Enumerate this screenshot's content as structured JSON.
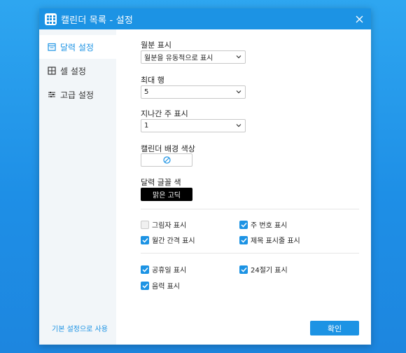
{
  "window": {
    "title": "캘린더 목록 - 설정"
  },
  "sidebar": {
    "items": [
      {
        "label": "달력 설정"
      },
      {
        "label": "셀 설정"
      },
      {
        "label": "고급 설정"
      }
    ]
  },
  "settings": {
    "month_display": {
      "label": "월분 표시",
      "value": "월분을 유동적으로 표시"
    },
    "max_rows": {
      "label": "최대 행",
      "value": "5"
    },
    "past_weeks": {
      "label": "지나간 주 표시",
      "value": "1"
    },
    "bg_color": {
      "label": "캘린더 배경 색상"
    },
    "font_color": {
      "label": "달력 글꼴 색",
      "value": "맑은 고딕"
    }
  },
  "checkboxes": {
    "shadow": {
      "label": "그림자 표시",
      "checked": false
    },
    "week_number": {
      "label": "주 번호 표시",
      "checked": true
    },
    "month_gap": {
      "label": "월간 간격 표시",
      "checked": true
    },
    "title_bar": {
      "label": "제목 표시줄 표시",
      "checked": true
    },
    "holidays": {
      "label": "공휴일 표시",
      "checked": true
    },
    "solar_terms": {
      "label": "24절기 표시",
      "checked": true
    },
    "lunar": {
      "label": "음력 표시",
      "checked": true
    }
  },
  "footer": {
    "reset_link": "기본 설정으로 사용",
    "ok_label": "확인"
  },
  "colors": {
    "accent": "#1c93e4",
    "sidebar_bg": "#f2f6f9"
  },
  "icons": {
    "app": "calendar-grid-icon",
    "close": "close-icon",
    "nav": [
      "calendar-icon",
      "grid-icon",
      "sliders-icon"
    ],
    "no_color": "no-color-icon",
    "dropdown": "chevron-down-icon",
    "check": "check-icon"
  }
}
